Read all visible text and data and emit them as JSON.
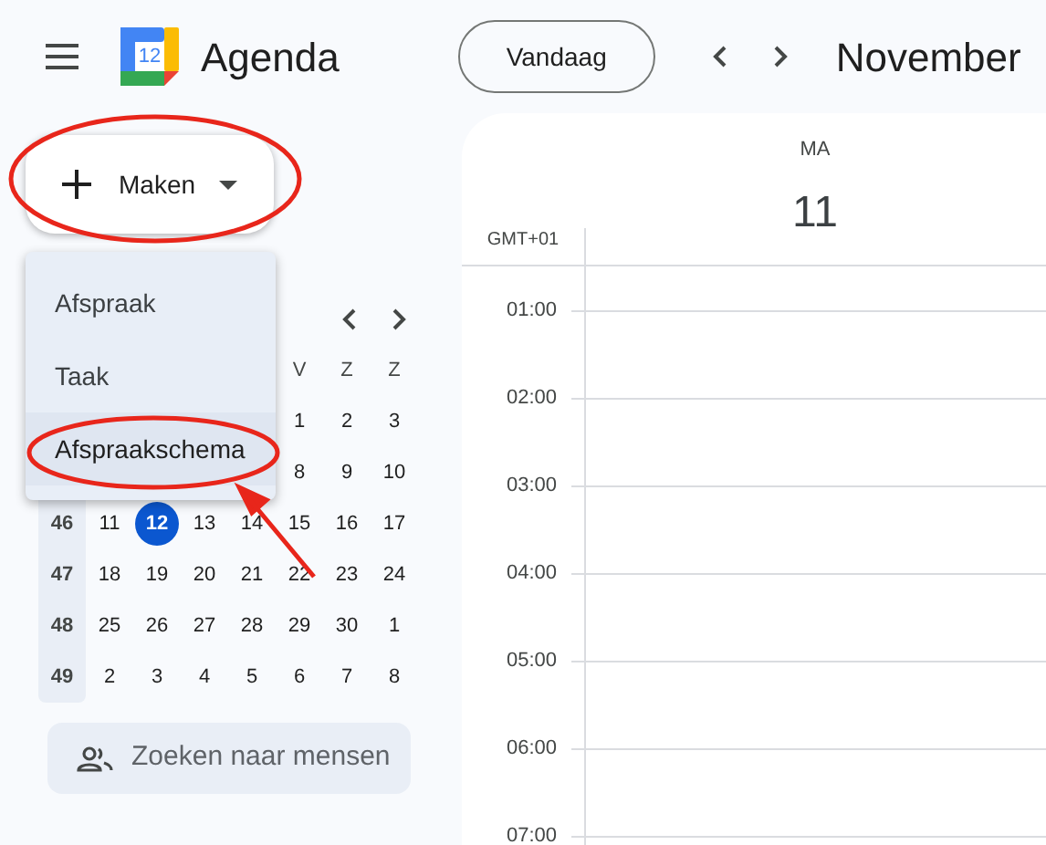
{
  "app": {
    "title": "Agenda",
    "logo_number": "12"
  },
  "toolbar": {
    "today_button": "Vandaag",
    "month": "November"
  },
  "create_button": {
    "label": "Maken"
  },
  "create_menu": [
    {
      "label": "Afspraak",
      "highlighted": false
    },
    {
      "label": "Taak",
      "highlighted": false
    },
    {
      "label": "Afspraakschema",
      "highlighted": true
    }
  ],
  "mini_calendar": {
    "weekday_headers": [
      "V",
      "Z",
      "Z"
    ],
    "weeks": [
      {
        "days": [
          {
            "day": "1",
            "selected": false
          },
          {
            "day": "2",
            "selected": false
          },
          {
            "day": "3",
            "selected": false
          }
        ]
      },
      {
        "days": [
          {
            "day": "8",
            "selected": false
          },
          {
            "day": "9",
            "selected": false
          },
          {
            "day": "10",
            "selected": false
          }
        ]
      },
      {
        "week": "46",
        "days": [
          {
            "day": "11",
            "selected": false
          },
          {
            "day": "12",
            "selected": true
          },
          {
            "day": "13",
            "selected": false
          },
          {
            "day": "14",
            "selected": false
          },
          {
            "day": "15",
            "selected": false
          },
          {
            "day": "16",
            "selected": false
          },
          {
            "day": "17",
            "selected": false
          }
        ]
      },
      {
        "week": "47",
        "days": [
          {
            "day": "18",
            "selected": false
          },
          {
            "day": "19",
            "selected": false
          },
          {
            "day": "20",
            "selected": false
          },
          {
            "day": "21",
            "selected": false
          },
          {
            "day": "22",
            "selected": false
          },
          {
            "day": "23",
            "selected": false
          },
          {
            "day": "24",
            "selected": false
          }
        ]
      },
      {
        "week": "48",
        "days": [
          {
            "day": "25",
            "selected": false
          },
          {
            "day": "26",
            "selected": false
          },
          {
            "day": "27",
            "selected": false
          },
          {
            "day": "28",
            "selected": false
          },
          {
            "day": "29",
            "selected": false
          },
          {
            "day": "30",
            "selected": false
          },
          {
            "day": "1",
            "selected": false
          }
        ]
      },
      {
        "week": "49",
        "days": [
          {
            "day": "2",
            "selected": false
          },
          {
            "day": "3",
            "selected": false
          },
          {
            "day": "4",
            "selected": false
          },
          {
            "day": "5",
            "selected": false
          },
          {
            "day": "6",
            "selected": false
          },
          {
            "day": "7",
            "selected": false
          },
          {
            "day": "8",
            "selected": false
          }
        ]
      }
    ]
  },
  "people_search": {
    "placeholder": "Zoeken naar mensen"
  },
  "day_view": {
    "weekday": "MA",
    "date": "11",
    "timezone": "GMT+01",
    "hours": [
      "01:00",
      "02:00",
      "03:00",
      "04:00",
      "05:00",
      "06:00",
      "07:00"
    ]
  }
}
